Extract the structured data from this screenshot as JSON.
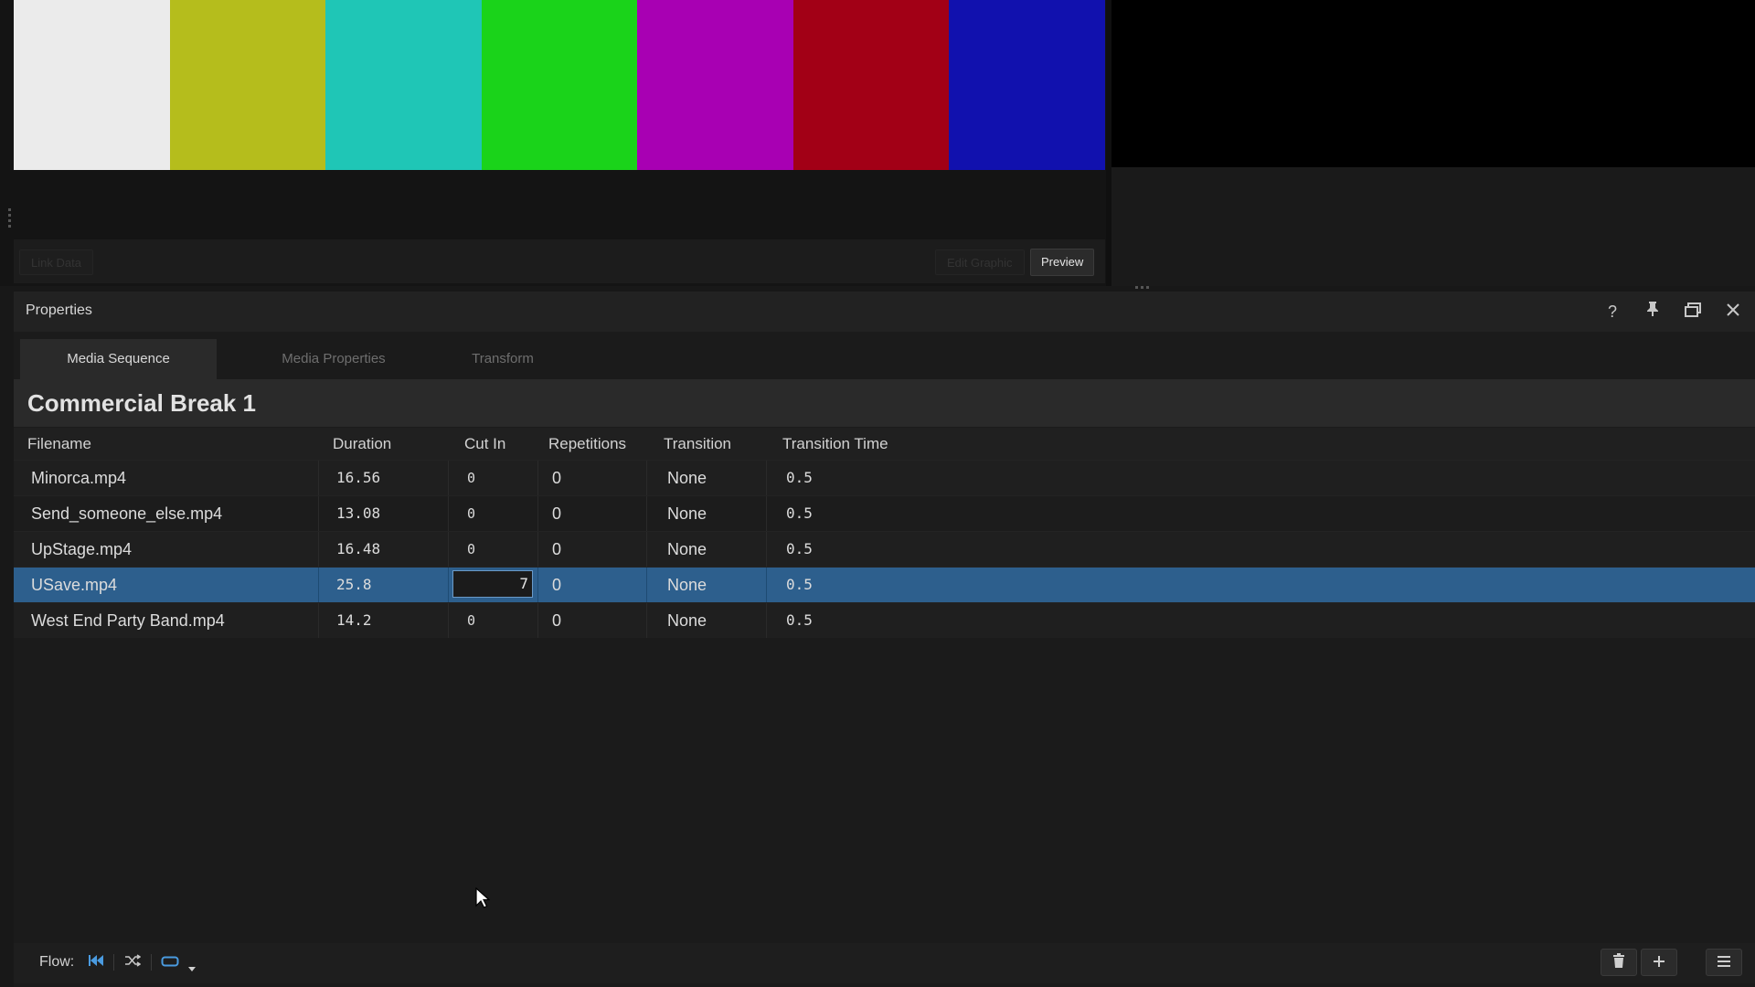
{
  "preview": {
    "colorbars": [
      "#ebebeb",
      "#b5bd1c",
      "#1fc6b6",
      "#1ad31a",
      "#a800b3",
      "#a20016",
      "#1111ae"
    ],
    "link_data_label": "Link Data",
    "edit_graphic_label": "Edit Graphic",
    "preview_label": "Preview"
  },
  "properties": {
    "title": "Properties",
    "header_icons": [
      "help-icon",
      "pin-icon",
      "float-window-icon",
      "close-icon"
    ],
    "tabs": [
      {
        "label": "Media Sequence",
        "active": true
      },
      {
        "label": "Media Properties",
        "active": false
      },
      {
        "label": "Transform",
        "active": false
      }
    ],
    "sequence_title": "Commercial Break 1",
    "columns": [
      "Filename",
      "Duration",
      "Cut In",
      "Repetitions",
      "Transition",
      "Transition Time"
    ],
    "rows": [
      {
        "filename": "Minorca.mp4",
        "duration": "16.56",
        "cut_in": "0",
        "repetitions": "0",
        "transition": "None",
        "transition_time": "0.5"
      },
      {
        "filename": "Send_someone_else.mp4",
        "duration": "13.08",
        "cut_in": "0",
        "repetitions": "0",
        "transition": "None",
        "transition_time": "0.5"
      },
      {
        "filename": "UpStage.mp4",
        "duration": "16.48",
        "cut_in": "0",
        "repetitions": "0",
        "transition": "None",
        "transition_time": "0.5"
      },
      {
        "filename": "USave.mp4",
        "duration": "25.8",
        "cut_in": "7",
        "repetitions": "0",
        "transition": "None",
        "transition_time": "0.5"
      },
      {
        "filename": "West End Party Band.mp4",
        "duration": "14.2",
        "cut_in": "0",
        "repetitions": "0",
        "transition": "None",
        "transition_time": "0.5"
      }
    ],
    "selected_row": 3,
    "selection_color": "#2d5f8d"
  },
  "footer": {
    "flow_label": "Flow:",
    "flow_icons": [
      "skip-to-start-icon",
      "shuffle-icon",
      "loop-icon",
      "dropdown-arrow-icon"
    ],
    "accent_color": "#4a9be0",
    "action_icons": [
      "trash-icon",
      "add-icon",
      "menu-icon"
    ]
  }
}
